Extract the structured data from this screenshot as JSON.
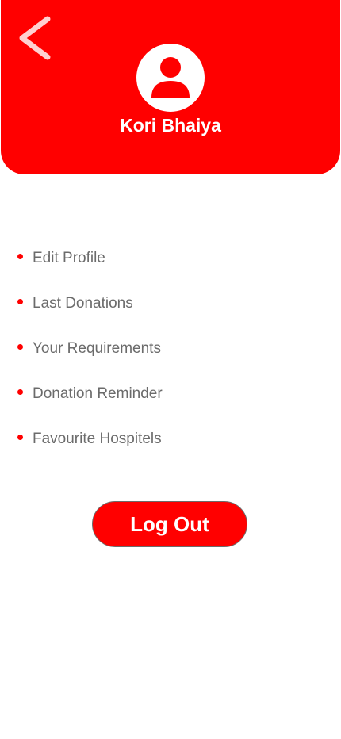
{
  "header": {
    "background_color": "#ff0000",
    "back_icon": "chevron-left-icon",
    "avatar_icon": "user-avatar-icon",
    "user_name": "Kori Bhaiya"
  },
  "menu": {
    "bullet_color": "#ff0000",
    "items": [
      {
        "label": "Edit Profile"
      },
      {
        "label": "Last Donations"
      },
      {
        "label": "Your Requirements"
      },
      {
        "label": "Donation Reminder"
      },
      {
        "label": "Favourite Hospitels"
      }
    ]
  },
  "logout": {
    "label": "Log Out",
    "color": "#ff0000"
  }
}
